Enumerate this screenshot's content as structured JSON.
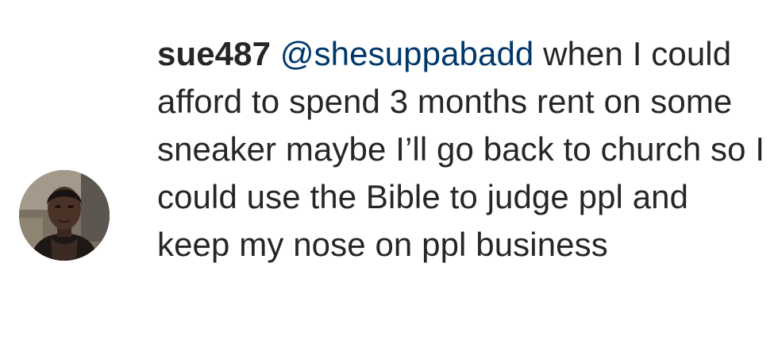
{
  "comment": {
    "username": "sue487",
    "mention": "@shesuppabadd",
    "text": "when I could afford to spend 3 months rent on some sneaker maybe I’ll go back to church so I could use the Bible to judge ppl and keep my nose on ppl business"
  },
  "icons": {
    "avatar": "profile-photo"
  },
  "colors": {
    "text": "#262626",
    "mention": "#00376b",
    "background": "#ffffff"
  }
}
